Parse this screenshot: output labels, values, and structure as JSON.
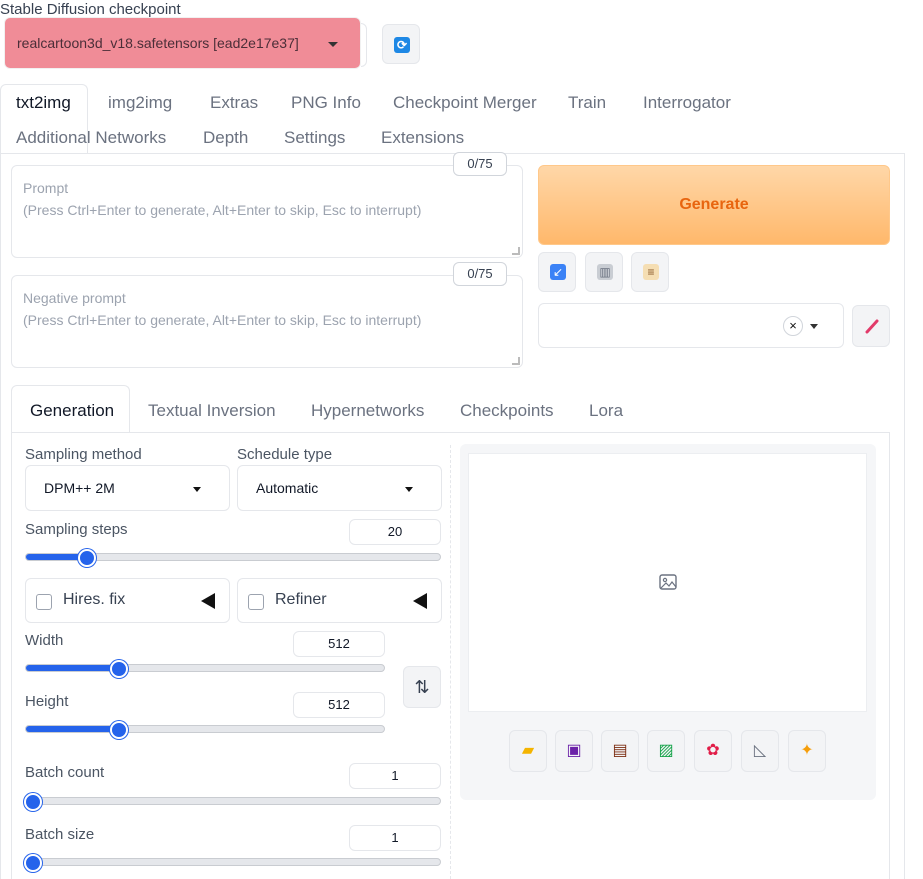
{
  "checkpoint": {
    "label": "Stable Diffusion checkpoint",
    "value": "realcartoon3d_v18.safetensors [ead2e17e37]",
    "highlight_color": "#f08c97"
  },
  "tabs": [
    "txt2img",
    "img2img",
    "Extras",
    "PNG Info",
    "Checkpoint Merger",
    "Train",
    "Interrogator",
    "Additional Networks",
    "Depth",
    "Settings",
    "Extensions"
  ],
  "prompt": {
    "label": "Prompt",
    "placeholder": "(Press Ctrl+Enter to generate, Alt+Enter to skip, Esc to interrupt)",
    "counter": "0/75"
  },
  "negative_prompt": {
    "label": "Negative prompt",
    "placeholder": "(Press Ctrl+Enter to generate, Alt+Enter to skip, Esc to interrupt)",
    "counter": "0/75"
  },
  "generate": {
    "label": "Generate",
    "color": "#e8650f"
  },
  "inner_tabs": [
    "Generation",
    "Textual Inversion",
    "Hypernetworks",
    "Checkpoints",
    "Lora"
  ],
  "sampling_method": {
    "label": "Sampling method",
    "value": "DPM++ 2M"
  },
  "schedule_type": {
    "label": "Schedule type",
    "value": "Automatic"
  },
  "sampling_steps": {
    "label": "Sampling steps",
    "value": "20",
    "fraction": 0.13
  },
  "hires_fix": {
    "label": "Hires. fix"
  },
  "refiner": {
    "label": "Refiner"
  },
  "width": {
    "label": "Width",
    "value": "512",
    "fraction": 0.24
  },
  "height": {
    "label": "Height",
    "value": "512",
    "fraction": 0.24
  },
  "batch_count": {
    "label": "Batch count",
    "value": "1",
    "fraction": 0.0
  },
  "batch_size": {
    "label": "Batch size",
    "value": "1",
    "fraction": 0.0
  },
  "accent_color": "#2563eb"
}
